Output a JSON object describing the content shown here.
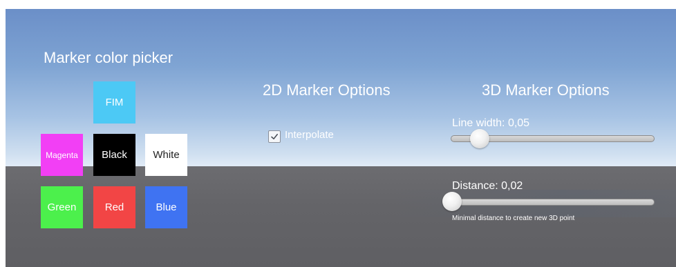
{
  "color_picker": {
    "title": "Marker color picker",
    "swatches": [
      {
        "label": "FIM",
        "color": "#4cc9f5"
      },
      {
        "label": "Magenta",
        "color": "#f23ff5"
      },
      {
        "label": "Black",
        "color": "#000000"
      },
      {
        "label": "White",
        "color": "#ffffff"
      },
      {
        "label": "Green",
        "color": "#4cf04c"
      },
      {
        "label": "Red",
        "color": "#f24545"
      },
      {
        "label": "Blue",
        "color": "#3f73f2"
      }
    ]
  },
  "marker_2d": {
    "title": "2D Marker Options",
    "interpolate_label": "Interpolate",
    "interpolate_checked": true
  },
  "marker_3d": {
    "title": "3D Marker Options",
    "line_width_label": "Line width: 0,05",
    "line_width_fraction": 0.06,
    "distance_label": "Distance: 0,02",
    "distance_fraction": 0.0,
    "distance_hint": "Minimal distance to create new 3D point"
  }
}
